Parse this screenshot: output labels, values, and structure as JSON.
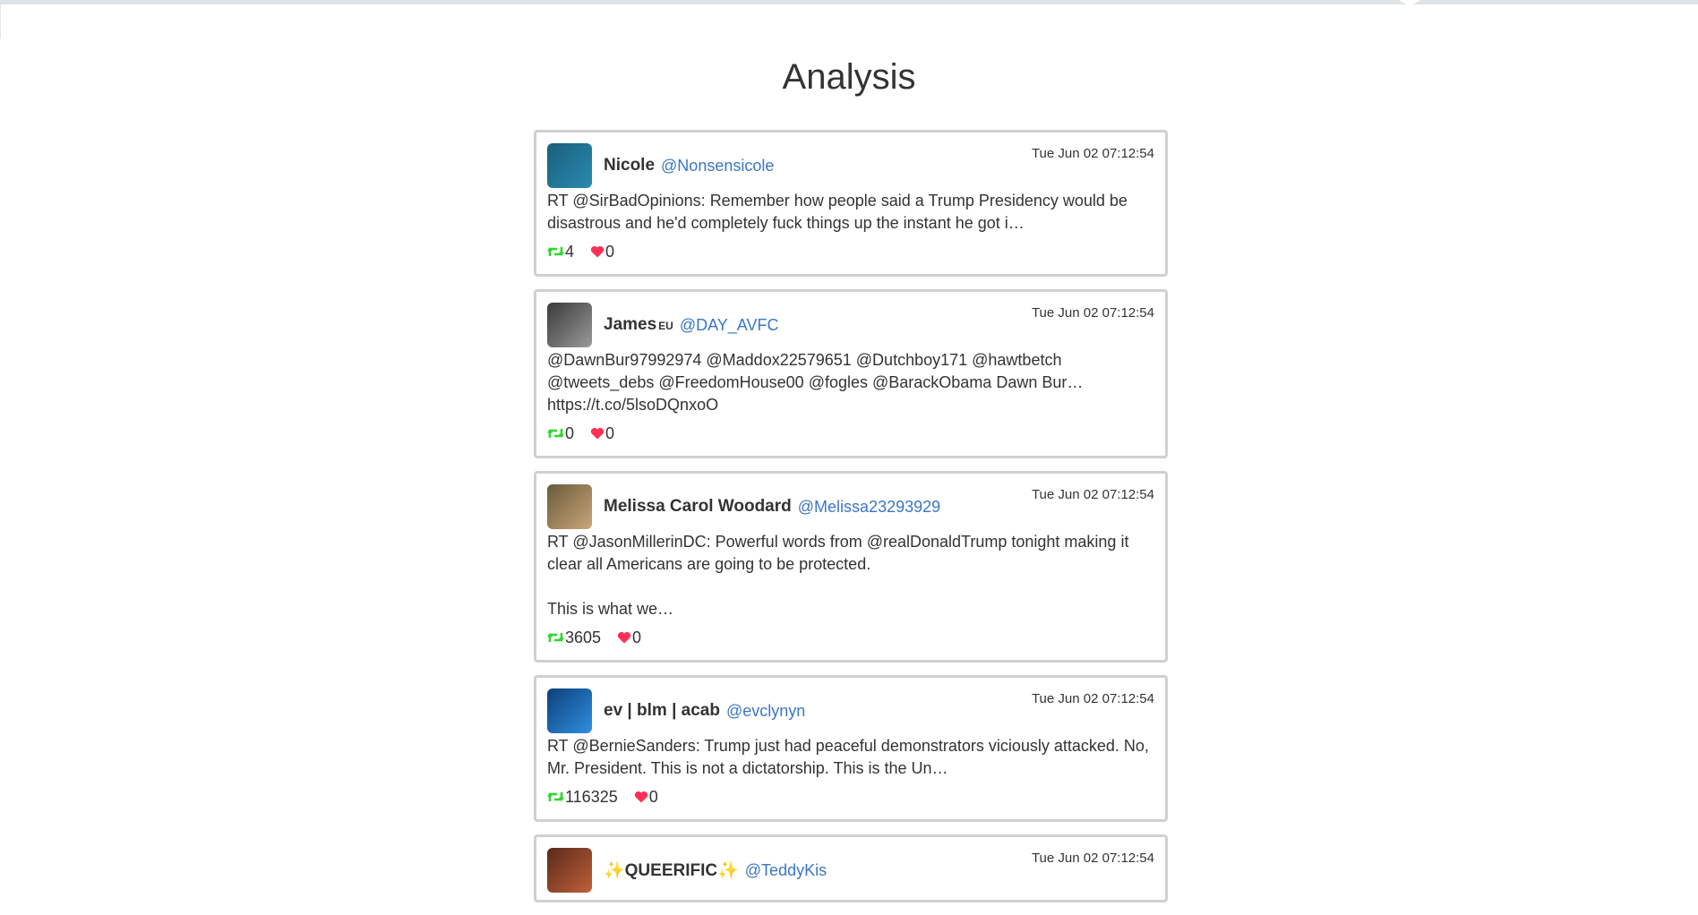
{
  "page": {
    "title": "Analysis"
  },
  "tweets": [
    {
      "name": "Nicole",
      "tag": "",
      "handle": "@Nonsensicole",
      "time": "Tue Jun 02 07:12:54",
      "text": "RT @SirBadOpinions: Remember how people said a Trump Presidency would be disastrous and he'd completely fuck things up the instant he got i…",
      "retweets": "4",
      "likes": "0",
      "avatar_colors": [
        "#1a5e7a",
        "#2a8bb0"
      ]
    },
    {
      "name": "James",
      "tag": "EU",
      "handle": "@DAY_AVFC",
      "time": "Tue Jun 02 07:12:54",
      "text": "@DawnBur97992974 @Maddox22579651 @Dutchboy171 @hawtbetch @tweets_debs @FreedomHouse00 @fogles @BarackObama Dawn Bur… https://t.co/5lsoDQnxoO",
      "retweets": "0",
      "likes": "0",
      "avatar_colors": [
        "#3a3a3a",
        "#9a9a9a"
      ]
    },
    {
      "name": "Melissa Carol Woodard",
      "tag": "",
      "handle": "@Melissa23293929",
      "time": "Tue Jun 02 07:12:54",
      "text": "RT @JasonMillerinDC: Powerful words from @realDonaldTrump tonight making it clear all Americans are going to be protected.\n\nThis is what we…",
      "retweets": "3605",
      "likes": "0",
      "avatar_colors": [
        "#6b5a3a",
        "#c9a67a"
      ]
    },
    {
      "name": "ev | blm | acab",
      "tag": "",
      "handle": "@evclynyn",
      "time": "Tue Jun 02 07:12:54",
      "text": "RT @BernieSanders: Trump just had peaceful demonstrators viciously attacked.  No, Mr. President. This is not a dictatorship. This is the Un…",
      "retweets": "116325",
      "likes": "0",
      "avatar_colors": [
        "#0d3f7a",
        "#2f8fe0"
      ]
    },
    {
      "name": "✨QUEERIFIC✨",
      "tag": "",
      "handle": "@TeddyKis",
      "time": "Tue Jun 02 07:12:54",
      "text": "",
      "retweets": "",
      "likes": "",
      "avatar_colors": [
        "#5a2a1a",
        "#c0603a"
      ]
    }
  ],
  "colors": {
    "retweet": "#2fd62f",
    "like": "#ff2f55",
    "handle": "#3b76c4",
    "card_border": "#d0d0d0"
  }
}
